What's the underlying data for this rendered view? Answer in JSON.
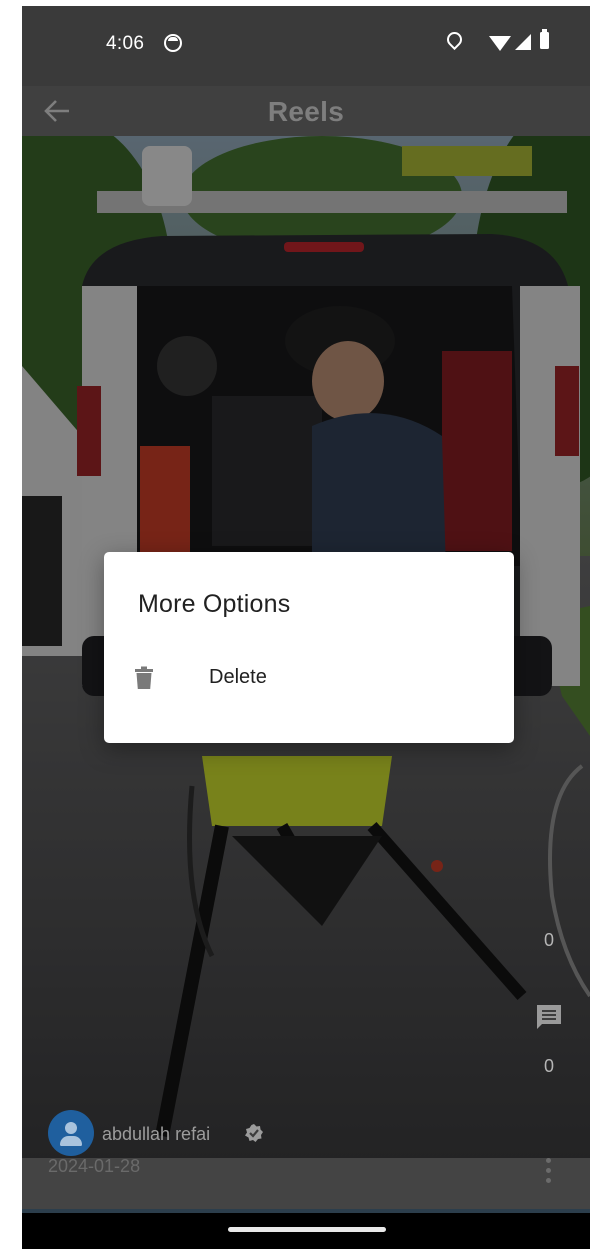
{
  "status_bar": {
    "time": "4:06",
    "icons": [
      "app-notification-icon",
      "location-icon",
      "wifi-icon",
      "signal-icon",
      "battery-icon"
    ]
  },
  "app_bar": {
    "title": "Reels",
    "back_icon": "back-arrow-icon"
  },
  "reel": {
    "like_count": "0",
    "comment_count": "0",
    "comment_icon": "comment-icon",
    "author_name": "abdullah refai",
    "author_verified_icon": "verified-badge-icon",
    "date": "2024-01-28",
    "more_icon": "more-vert-icon"
  },
  "dialog": {
    "title": "More Options",
    "items": [
      {
        "icon": "trash-icon",
        "label": "Delete"
      }
    ]
  },
  "colors": {
    "scrim": "#000000",
    "dialog_bg": "#ffffff",
    "avatar_bg": "#1f5f9e",
    "status_bar_bg": "#3a3a3a"
  }
}
